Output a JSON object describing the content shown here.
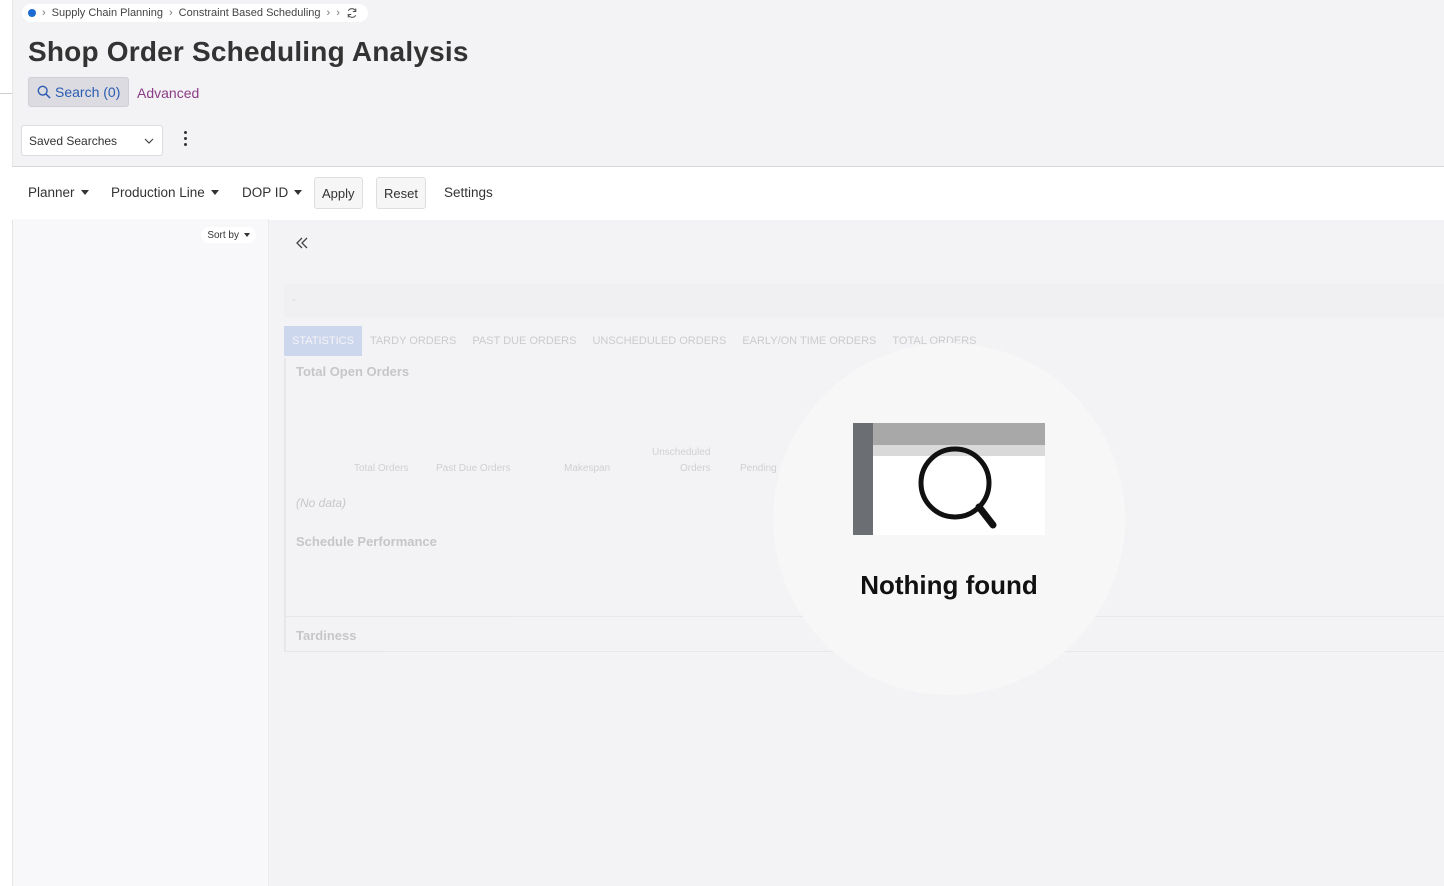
{
  "breadcrumb": {
    "items": [
      "Supply Chain Planning",
      "Constraint Based Scheduling"
    ]
  },
  "page": {
    "title": "Shop Order Scheduling Analysis"
  },
  "search": {
    "search_label": "Search (0)",
    "advanced_label": "Advanced",
    "saved_searches_label": "Saved Searches"
  },
  "filters": {
    "planner": "Planner",
    "production_line": "Production Line",
    "dop_id": "DOP ID",
    "apply": "Apply",
    "reset": "Reset",
    "settings": "Settings"
  },
  "side_panel": {
    "sort_by": "Sort by"
  },
  "background_content": {
    "header_text": "-",
    "tabs": [
      "STATISTICS",
      "TARDY ORDERS",
      "PAST DUE ORDERS",
      "UNSCHEDULED ORDERS",
      "EARLY/ON TIME ORDERS",
      "TOTAL ORDERS"
    ],
    "active_tab": "STATISTICS",
    "total_open_orders_title": "Total Open Orders",
    "chart_labels": {
      "total_orders": "Total Orders",
      "past_due_orders": "Past Due Orders",
      "makespan": "Makespan",
      "unscheduled_line1": "Unscheduled",
      "unscheduled_line2": "Orders",
      "pending": "Pending"
    },
    "no_data": "(No data)",
    "schedule_performance_title": "Schedule Performance",
    "tardiness_title": "Tardiness"
  },
  "empty_state": {
    "message": "Nothing found"
  },
  "colors": {
    "accent_blue": "#2a5db0",
    "advanced_purple": "#8a3d86",
    "home_dot": "#1b6bd1"
  }
}
